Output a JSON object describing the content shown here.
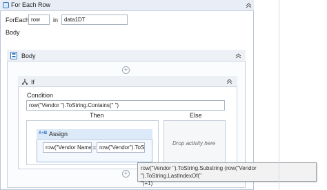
{
  "foreach": {
    "title": "For Each Row",
    "foreach_label": "ForEach",
    "item_var": "row",
    "in_label": "in",
    "collection": "data1DT",
    "body_label": "Body",
    "collapse_icon": "chevron-double-up"
  },
  "body_sequence": {
    "title": "Body",
    "collapse_icon": "chevron-double-up"
  },
  "if_activity": {
    "title": "If",
    "condition_label": "Condition",
    "condition_value": "row(\"Vendor \").ToString.Contains(\"    \")",
    "then_label": "Then",
    "else_label": "Else",
    "else_placeholder": "Drop activity here",
    "collapse_icon": "chevron-double-up"
  },
  "assign": {
    "icon_text": "A+B",
    "title": "Assign",
    "to_value": "row(\"Vendor Name",
    "equals": "=",
    "value_value": "row(\"Vendor\").ToS"
  },
  "tooltip": {
    "line1": "row(\"Vendor \").ToString.Substring (row(\"Vendor \").ToString.LastIndexOf(\"",
    "line2": "\")+1)"
  },
  "add_symbol": "+",
  "colors": {
    "accent": "#2f74c0",
    "header_bg": "#e9eef6",
    "assign_header": "#dbe9f8"
  }
}
